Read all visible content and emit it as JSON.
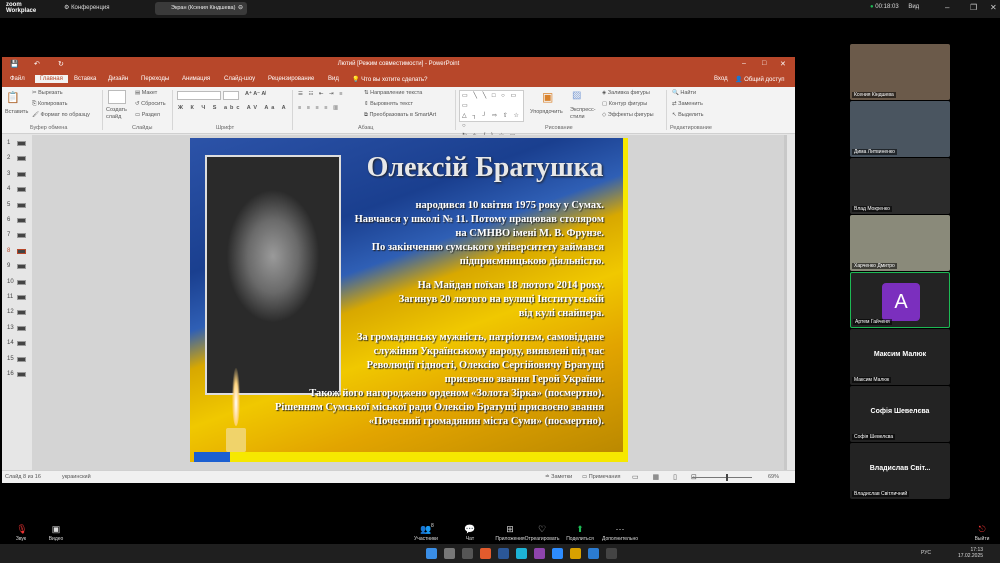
{
  "zoom": {
    "logo_line1": "zoom",
    "logo_line2": "Workplace",
    "conference_label": "Конференция",
    "share_label": "Экран (Ксения Кіндшева)",
    "timer": "00:18:03",
    "view_label": "Вид"
  },
  "ppt": {
    "title": "Лютий [Режим совместимости] - PowerPoint",
    "tabs": [
      "Файл",
      "Главная",
      "Вставка",
      "Дизайн",
      "Переходы",
      "Анимация",
      "Слайд-шоу",
      "Рецензирование",
      "Вид"
    ],
    "search_hint": "Что вы хотите сделать?",
    "login": "Вход",
    "share": "Общий доступ",
    "ribbon": {
      "paste": "Вставить",
      "cut": "Вырезать",
      "copy": "Копировать",
      "format_painter": "Формат по образцу",
      "create_slide": "Создать слайд",
      "layout": "Макет",
      "reset": "Сбросить",
      "section": "Раздел",
      "text_direction": "Направление текста",
      "align_text": "Выровнять текст",
      "smartart": "Преобразовать в SmartArt",
      "arrange": "Упорядочить",
      "express_styles": "Экспресс-стили",
      "shape_fill": "Заливка фигуры",
      "shape_outline": "Контур фигуры",
      "shape_effects": "Эффекты фигуры",
      "find": "Найти",
      "replace": "Заменить",
      "select": "Выделить",
      "groups": [
        "Буфер обмена",
        "Слайды",
        "Шрифт",
        "Абзац",
        "Рисование",
        "Редактирование"
      ]
    },
    "thumb_numbers": [
      "1",
      "2",
      "3",
      "4",
      "5",
      "6",
      "7",
      "8",
      "9",
      "10",
      "11",
      "12",
      "13",
      "14",
      "15",
      "16"
    ],
    "status": {
      "slide_of": "Слайд 8 из 16",
      "language": "украинский",
      "notes": "Заметки",
      "comments": "Примечания",
      "zoom": "69%"
    }
  },
  "slide": {
    "title": "Олексій Братушка",
    "lines": [
      "народився 10 квітня 1975 року у Сумах.",
      "Навчався у школі № 11. Потому працював столяром",
      "на СМНВО імені М. В. Фрунзе.",
      "По закінченню сумського університету займався",
      "підприємницькою діяльністю.",
      "На Майдан поїхав 18 лютого 2014 року.",
      "Загинув 20 лютого на вулиці Інститутській",
      "від кулі снайпера.",
      "За громадянську мужність, патріотизм, самовіддане",
      "служіння Українському народу, виявлені під час",
      "Революції гідності, Олексію Сергійовичу Братущі",
      "присвоєно звання Герой України.",
      "Також його нагороджено орденом «Золота Зірка» (посмертно).",
      "Рішенням Сумської міської ради Олексію Братущі присвоєно звання",
      "«Почесний громадянин міста Суми» (посмертно)."
    ]
  },
  "participants": [
    {
      "name": "Ксения Кіндшева",
      "type": "video"
    },
    {
      "name": "Дима Литвиненко",
      "type": "video"
    },
    {
      "name": "Влад Мокренко",
      "type": "video"
    },
    {
      "name": "Харченко Дмитро",
      "type": "video"
    },
    {
      "name": "Артем Гайченя",
      "type": "avatar",
      "initial": "A",
      "color": "#7b2fbe"
    },
    {
      "name": "Максим Малюк",
      "type": "name"
    },
    {
      "name": "Софія Шевелєва",
      "type": "name"
    },
    {
      "name": "Владислав Світ...",
      "full": "Владислав Світличний",
      "type": "name"
    }
  ],
  "toolbar": {
    "audio": "Звук",
    "video": "Видео",
    "participants": "Участники",
    "participants_count": "8",
    "chat": "Чат",
    "apps": "Приложения",
    "react": "Отреагировать",
    "share": "Поделиться",
    "more": "Дополнительно",
    "leave": "Выйти"
  },
  "taskbar": {
    "lang": "РУС",
    "time": "17:13",
    "date": "17.02.2025"
  },
  "colors": {
    "ppt_accent": "#b7472a",
    "avatar": "#7b2fbe",
    "share_green": "#1db954"
  }
}
